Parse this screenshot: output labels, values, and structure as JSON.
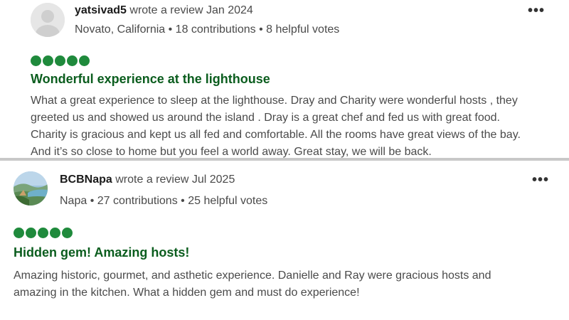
{
  "reviews": [
    {
      "username": "yatsivad5",
      "wrote": "wrote a review Jan 2024",
      "meta": "Novato, California • 18 contributions • 8 helpful votes",
      "rating": 5,
      "title": "Wonderful experience at the lighthouse",
      "body": [
        "What a great experience to sleep at the lighthouse. Dray and Charity were wonderful hosts , they",
        "greeted us and showed us around the island . Dray is a great chef and fed us with great food.",
        "Charity is gracious and kept us all fed and comfortable. All the rooms have great views of the bay.",
        "And it’s so close to home but you feel a world away. Great stay, we will be back."
      ],
      "more_label": "•••"
    },
    {
      "username": "BCBNapa",
      "wrote": "wrote a review Jul 2025",
      "meta": "Napa • 27 contributions • 25 helpful votes",
      "rating": 5,
      "title": "Hidden gem! Amazing hosts!",
      "body": [
        "Amazing historic, gourmet, and asthetic experience. Danielle and Ray were gracious hosts and",
        "amazing in the kitchen. What a hidden gem and must do experience!"
      ],
      "more_label": "•••"
    }
  ],
  "colors": {
    "rating_bubble": "#1f8a3c",
    "title": "#0b5d1e",
    "separator": "#c8c8c8"
  },
  "icons": {
    "default_avatar": "user-silhouette-icon",
    "photo_avatar": "landscape-avatar",
    "more": "more-options-icon"
  }
}
